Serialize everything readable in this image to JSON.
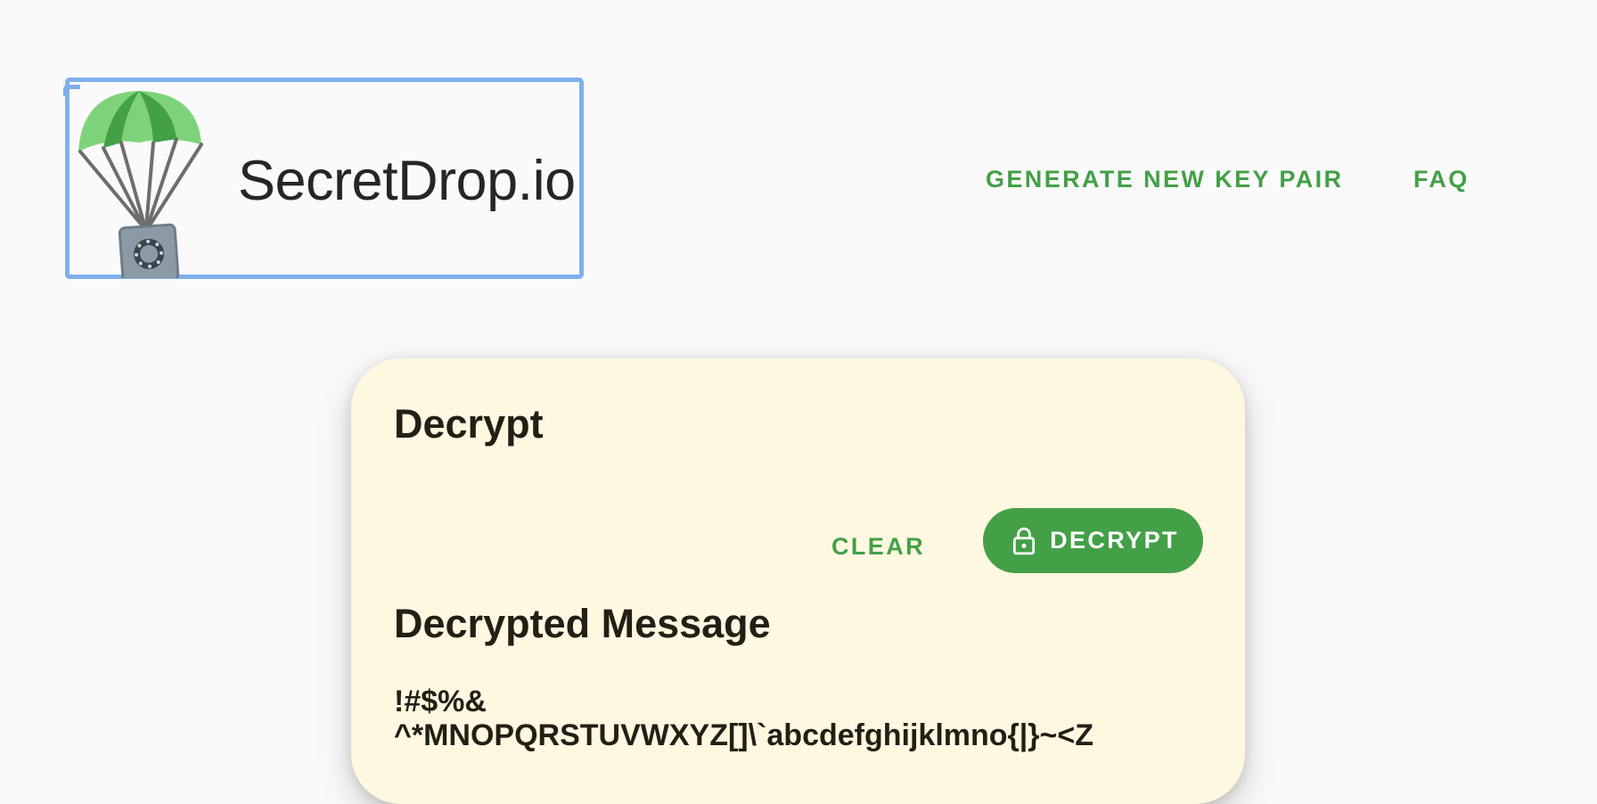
{
  "header": {
    "brand": "SecretDrop.io",
    "logo_icon": "parachute-safe-icon",
    "nav": [
      {
        "label": "GENERATE NEW KEY PAIR"
      },
      {
        "label": "FAQ"
      }
    ]
  },
  "card": {
    "title": "Decrypt",
    "clear_label": "CLEAR",
    "decrypt_label": "DECRYPT",
    "decrypt_icon": "lock-icon",
    "result_title": "Decrypted Message",
    "message_line1": "!#$%&",
    "message_line2": "^*MNOPQRSTUVWXYZ[]\\`abcdefghijklmno{|}~<Z"
  },
  "colors": {
    "accent": "#43a047",
    "card_bg": "#fff8e1",
    "page_bg": "#fafafa",
    "focus_outline": "#7fb0ec",
    "text": "#231f14"
  }
}
